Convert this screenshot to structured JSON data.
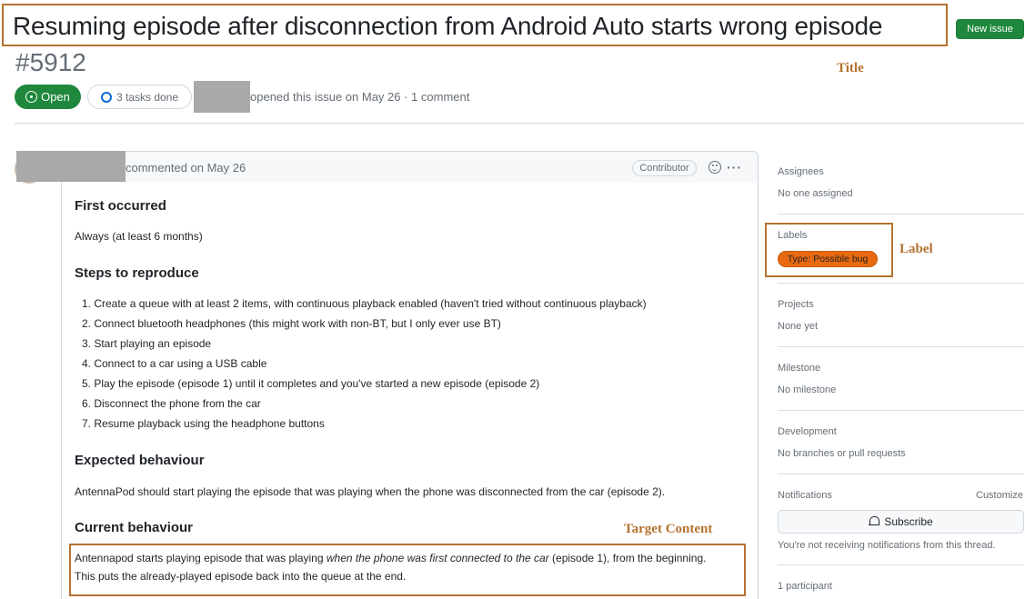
{
  "header": {
    "title": "Resuming episode after disconnection from Android Auto starts wrong episode",
    "issue_number": "#5912",
    "new_issue_label": "New issue",
    "state_label": "Open",
    "tasks_label": "3 tasks done",
    "meta": "opened this issue on May 26 · 1 comment"
  },
  "annotations": {
    "title": "Title",
    "label": "Label",
    "target": "Target Content"
  },
  "comment": {
    "date": "commented on May 26",
    "role": "Contributor",
    "sections": {
      "first_occurred_heading": "First occurred",
      "first_occurred_text": "Always (at least 6 months)",
      "steps_heading": "Steps to reproduce",
      "steps": [
        "1. Create a queue with at least 2 items, with continuous playback enabled (haven't tried without continuous playback)",
        "2. Connect bluetooth headphones (this might work with non-BT, but I only ever use BT)",
        "3. Start playing an episode",
        "4. Connect to a car using a USB cable",
        "5. Play the episode (episode 1) until it completes and you've started a new episode (episode 2)",
        "6. Disconnect the phone from the car",
        "7. Resume playback using the headphone buttons"
      ],
      "expected_heading": "Expected behaviour",
      "expected_text": "AntennaPod should start playing the episode that was playing when the phone was disconnected from the car (episode 2).",
      "current_heading": "Current behaviour",
      "current_line1_a": "Antennapod starts playing episode that was playing ",
      "current_line1_em": "when the phone was first connected to the car",
      "current_line1_b": " (episode 1), from the beginning.",
      "current_line2": "This puts the already-played episode back into the queue at the end."
    }
  },
  "sidebar": {
    "assignees_title": "Assignees",
    "assignees_value": "No one assigned",
    "labels_title": "Labels",
    "label_pill": "Type: Possible bug",
    "label_color": "#e8690f",
    "projects_title": "Projects",
    "projects_value": "None yet",
    "milestone_title": "Milestone",
    "milestone_value": "No milestone",
    "development_title": "Development",
    "development_value": "No branches or pull requests",
    "notifications_title": "Notifications",
    "customize_label": "Customize",
    "subscribe_label": "Subscribe",
    "notifications_note": "You're not receiving notifications from this thread.",
    "participants": "1 participant"
  },
  "icons": [
    "issue-opened-icon",
    "tasks-progress-icon",
    "smiley-icon",
    "kebab-horizontal-icon",
    "bell-icon"
  ],
  "colors": {
    "accent_green": "#1f883d",
    "annotation_brown": "#b4722f",
    "progress_blue": "#0969da"
  }
}
